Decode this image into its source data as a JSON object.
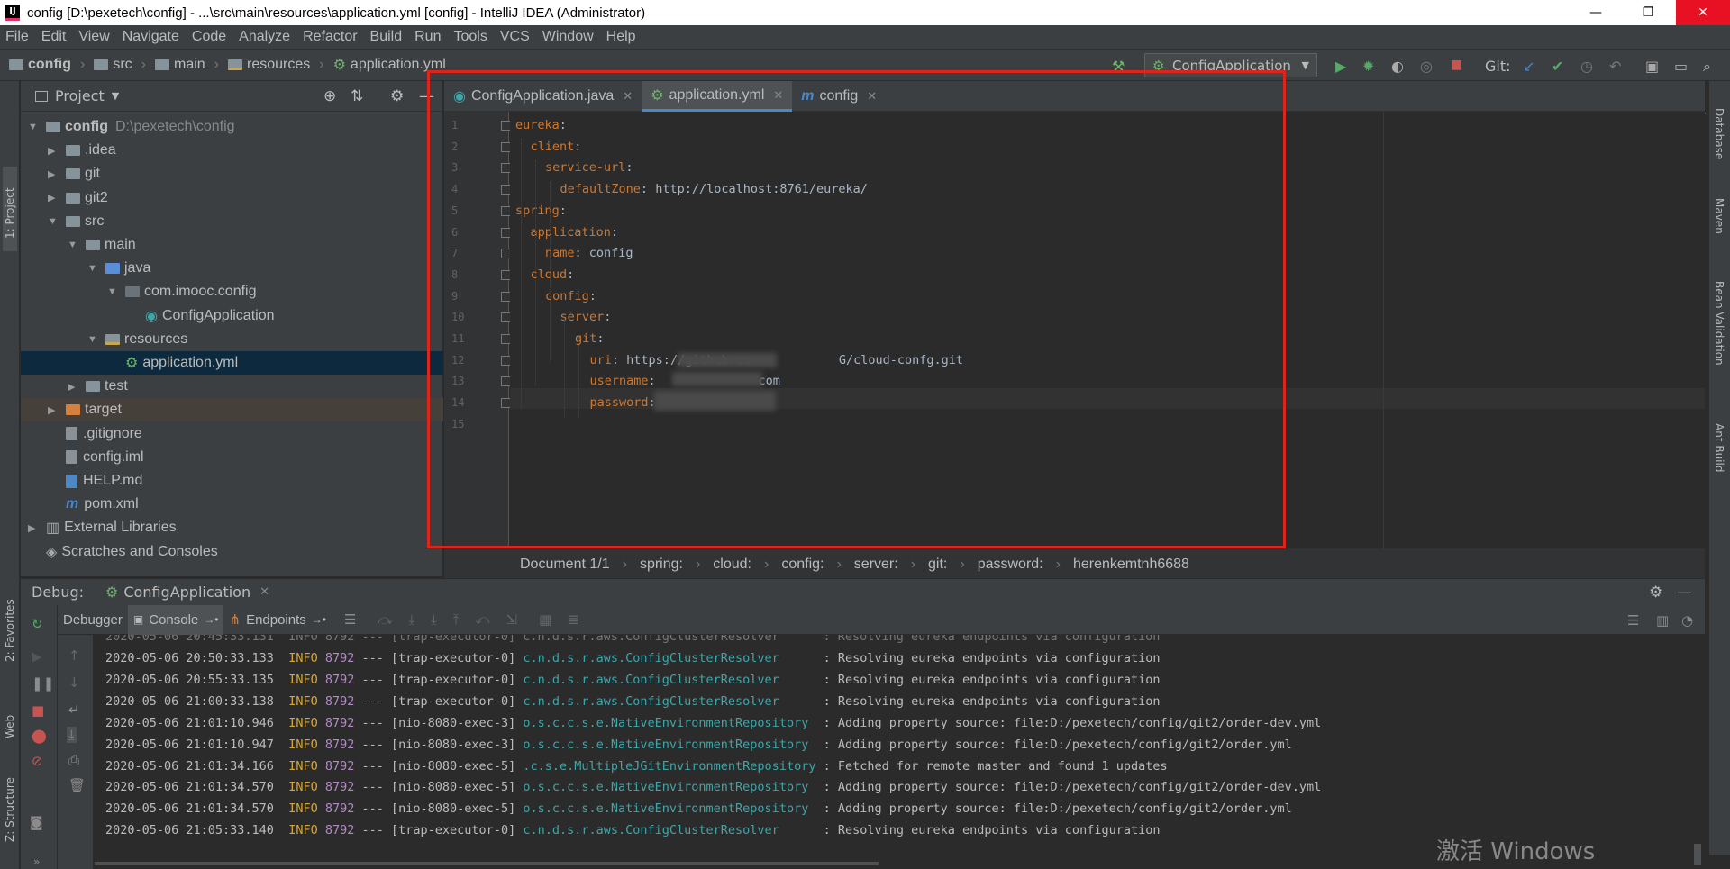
{
  "window": {
    "title": "config [D:\\pexetech\\config] - ...\\src\\main\\resources\\application.yml [config] - IntelliJ IDEA (Administrator)",
    "minimize": "—",
    "restore": "❐",
    "close": "✕"
  },
  "menu": [
    "File",
    "Edit",
    "View",
    "Navigate",
    "Code",
    "Analyze",
    "Refactor",
    "Build",
    "Run",
    "Tools",
    "VCS",
    "Window",
    "Help"
  ],
  "breadcrumb": [
    "config",
    "src",
    "main",
    "resources",
    "application.yml"
  ],
  "toolbar": {
    "run_config": "ConfigApplication",
    "git_label": "Git:"
  },
  "left_strip": {
    "project": "1: Project",
    "favorites": "2: Favorites",
    "web": "Web",
    "structure": "Z: Structure"
  },
  "right_strip": {
    "database": "Database",
    "maven": "Maven",
    "bean": "Bean Validation",
    "ant": "Ant Build"
  },
  "project_panel": {
    "title": "Project",
    "tree": [
      {
        "label": "config",
        "extra": "D:\\pexetech\\config",
        "depth": 0,
        "arrow": "▼",
        "icon": "folder"
      },
      {
        "label": ".idea",
        "depth": 1,
        "arrow": "▶",
        "icon": "folder"
      },
      {
        "label": "git",
        "depth": 1,
        "arrow": "▶",
        "icon": "folder"
      },
      {
        "label": "git2",
        "depth": 1,
        "arrow": "▶",
        "icon": "folder"
      },
      {
        "label": "src",
        "depth": 1,
        "arrow": "▼",
        "icon": "folder"
      },
      {
        "label": "main",
        "depth": 2,
        "arrow": "▼",
        "icon": "folder"
      },
      {
        "label": "java",
        "depth": 3,
        "arrow": "▼",
        "icon": "folder-blue"
      },
      {
        "label": "com.imooc.config",
        "depth": 4,
        "arrow": "▼",
        "icon": "package"
      },
      {
        "label": "ConfigApplication",
        "depth": 5,
        "arrow": "",
        "icon": "spring-class"
      },
      {
        "label": "resources",
        "depth": 3,
        "arrow": "▼",
        "icon": "folder-res"
      },
      {
        "label": "application.yml",
        "depth": 4,
        "arrow": "",
        "icon": "yml",
        "selected": true
      },
      {
        "label": "test",
        "depth": 2,
        "arrow": "▶",
        "icon": "folder"
      },
      {
        "label": "target",
        "depth": 1,
        "arrow": "▶",
        "icon": "folder-orange",
        "target": true
      },
      {
        "label": ".gitignore",
        "depth": 1,
        "arrow": "",
        "icon": "file"
      },
      {
        "label": "config.iml",
        "depth": 1,
        "arrow": "",
        "icon": "file"
      },
      {
        "label": "HELP.md",
        "depth": 1,
        "arrow": "",
        "icon": "md"
      },
      {
        "label": "pom.xml",
        "depth": 1,
        "arrow": "",
        "icon": "maven"
      },
      {
        "label": "External Libraries",
        "depth": 0,
        "arrow": "▶",
        "icon": "libs"
      },
      {
        "label": "Scratches and Consoles",
        "depth": 0,
        "arrow": "",
        "icon": "scratch"
      }
    ]
  },
  "editor_tabs": [
    {
      "label": "ConfigApplication.java",
      "active": false
    },
    {
      "label": "application.yml",
      "active": true
    },
    {
      "label": "config",
      "active": false
    }
  ],
  "code_lines": [
    {
      "n": "1",
      "indent": 0,
      "key": "eureka",
      "val": ""
    },
    {
      "n": "2",
      "indent": 1,
      "key": "client",
      "val": ""
    },
    {
      "n": "3",
      "indent": 2,
      "key": "service-url",
      "val": ""
    },
    {
      "n": "4",
      "indent": 3,
      "key": "defaultZone",
      "val": "http://localhost:8761/eureka/"
    },
    {
      "n": "5",
      "indent": 0,
      "key": "spring",
      "val": ""
    },
    {
      "n": "6",
      "indent": 1,
      "key": "application",
      "val": ""
    },
    {
      "n": "7",
      "indent": 2,
      "key": "name",
      "val": "config"
    },
    {
      "n": "8",
      "indent": 1,
      "key": "cloud",
      "val": ""
    },
    {
      "n": "9",
      "indent": 2,
      "key": "config",
      "val": ""
    },
    {
      "n": "10",
      "indent": 3,
      "key": "server",
      "val": ""
    },
    {
      "n": "11",
      "indent": 4,
      "key": "git",
      "val": ""
    },
    {
      "n": "12",
      "indent": 5,
      "key": "uri",
      "val": "https://github.co            G/cloud-confg.git"
    },
    {
      "n": "13",
      "indent": 5,
      "key": "username",
      "val": "             com"
    },
    {
      "n": "14",
      "indent": 5,
      "key": "password",
      "val": ""
    },
    {
      "n": "15",
      "indent": 0,
      "key": "",
      "val": ""
    }
  ],
  "editor_breadcrumb": [
    "Document 1/1",
    "spring:",
    "cloud:",
    "config:",
    "server:",
    "git:",
    "password:",
    "herenkemtnh6688"
  ],
  "debug": {
    "label": "Debug:",
    "session": "ConfigApplication",
    "tabs": [
      "Debugger",
      "Console",
      "Endpoints"
    ]
  },
  "console_lines": [
    {
      "ts": "2020-05-06 20:50:33.133",
      "lvl": "INFO",
      "pid": "8792",
      "thread": "--- [trap-executor-0]",
      "cls": "c.n.d.s.r.aws.ConfigClusterResolver     ",
      "msg": ": Resolving eureka endpoints via configuration"
    },
    {
      "ts": "2020-05-06 20:55:33.135",
      "lvl": "INFO",
      "pid": "8792",
      "thread": "--- [trap-executor-0]",
      "cls": "c.n.d.s.r.aws.ConfigClusterResolver     ",
      "msg": ": Resolving eureka endpoints via configuration"
    },
    {
      "ts": "2020-05-06 21:00:33.138",
      "lvl": "INFO",
      "pid": "8792",
      "thread": "--- [trap-executor-0]",
      "cls": "c.n.d.s.r.aws.ConfigClusterResolver     ",
      "msg": ": Resolving eureka endpoints via configuration"
    },
    {
      "ts": "2020-05-06 21:01:10.946",
      "lvl": "INFO",
      "pid": "8792",
      "thread": "--- [nio-8080-exec-3]",
      "cls": "o.s.c.c.s.e.NativeEnvironmentRepository ",
      "msg": ": Adding property source: file:D:/pexetech/config/git2/order-dev.yml"
    },
    {
      "ts": "2020-05-06 21:01:10.947",
      "lvl": "INFO",
      "pid": "8792",
      "thread": "--- [nio-8080-exec-3]",
      "cls": "o.s.c.c.s.e.NativeEnvironmentRepository ",
      "msg": ": Adding property source: file:D:/pexetech/config/git2/order.yml"
    },
    {
      "ts": "2020-05-06 21:01:34.166",
      "lvl": "INFO",
      "pid": "8792",
      "thread": "--- [nio-8080-exec-5]",
      "cls": ".c.s.e.MultipleJGitEnvironmentRepository",
      "msg": ": Fetched for remote master and found 1 updates"
    },
    {
      "ts": "2020-05-06 21:01:34.570",
      "lvl": "INFO",
      "pid": "8792",
      "thread": "--- [nio-8080-exec-5]",
      "cls": "o.s.c.c.s.e.NativeEnvironmentRepository ",
      "msg": ": Adding property source: file:D:/pexetech/config/git2/order-dev.yml"
    },
    {
      "ts": "2020-05-06 21:01:34.570",
      "lvl": "INFO",
      "pid": "8792",
      "thread": "--- [nio-8080-exec-5]",
      "cls": "o.s.c.c.s.e.NativeEnvironmentRepository ",
      "msg": ": Adding property source: file:D:/pexetech/config/git2/order.yml"
    },
    {
      "ts": "2020-05-06 21:05:33.140",
      "lvl": "INFO",
      "pid": "8792",
      "thread": "--- [trap-executor-0]",
      "cls": "c.n.d.s.r.aws.ConfigClusterResolver     ",
      "msg": ": Resolving eureka endpoints via configuration"
    }
  ],
  "watermark": "激活 Windows",
  "colors": {
    "accent": "#4a88c7",
    "annotation": "#e0241b",
    "key": "#cc7832",
    "class": "#3fa5a8",
    "info": "#d4a53c"
  }
}
